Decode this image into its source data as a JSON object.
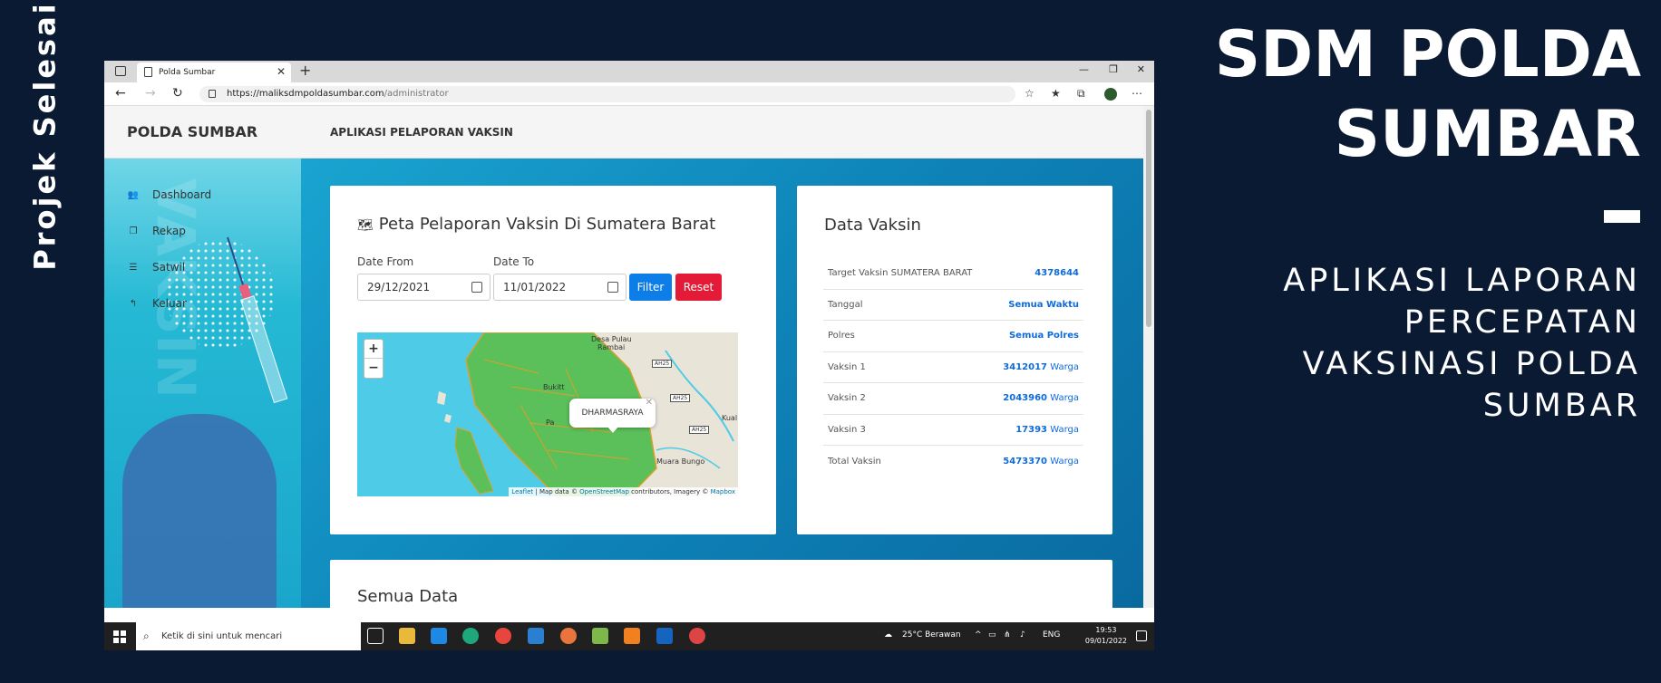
{
  "slide": {
    "vertical_label": "Projek Selesai",
    "title_line1": "SDM POLDA",
    "title_line2": "SUMBAR",
    "subtitle_line1": "APLIKASI LAPORAN",
    "subtitle_line2": "PERCEPATAN",
    "subtitle_line3": "VAKSINASI POLDA",
    "subtitle_line4": "SUMBAR"
  },
  "browser": {
    "tab_title": "Polda Sumbar",
    "url_host": "https://maliksdmpoldasumbar.com",
    "url_path": "/administrator"
  },
  "app": {
    "brand": "POLDA SUMBAR",
    "topbar_title": "APLIKASI PELAPORAN VAKSIN",
    "menu": [
      {
        "label": "Dashboard",
        "icon": "users-icon"
      },
      {
        "label": "Rekap",
        "icon": "copy-icon"
      },
      {
        "label": "Satwil",
        "icon": "list-icon"
      },
      {
        "label": "Keluar",
        "icon": "logout-icon"
      }
    ]
  },
  "map_card": {
    "title": "Peta Pelaporan Vaksin Di Sumatera Barat",
    "date_from_label": "Date From",
    "date_to_label": "Date To",
    "date_from_value": "29/12/2021",
    "date_to_value": "11/01/2022",
    "filter_label": "Filter",
    "reset_label": "Reset",
    "popup_text": "DHARMASRAYA",
    "zoom_in": "+",
    "zoom_out": "−",
    "attribution_leaflet": "Leaflet",
    "attribution_mid": " | Map data © ",
    "attribution_osm": "OpenStreetMap",
    "attribution_mid2": " contributors, Imagery © ",
    "attribution_mapbox": "Mapbox",
    "places": {
      "desa": "Desa Pulau",
      "rambai": "Rambai",
      "bukit": "Bukitt",
      "pa": "Pa",
      "kual": "Kual",
      "muara": "Muara Bungo"
    },
    "roads": [
      "AH25",
      "AH25",
      "AH25"
    ]
  },
  "data_card": {
    "title": "Data Vaksin",
    "rows": [
      {
        "label": "Target Vaksin SUMATERA BARAT",
        "value": "4378644",
        "unit": ""
      },
      {
        "label": "Tanggal",
        "value": "Semua Waktu",
        "unit": ""
      },
      {
        "label": "Polres",
        "value": "Semua Polres",
        "unit": ""
      },
      {
        "label": "Vaksin 1",
        "value": "3412017",
        "unit": "Warga"
      },
      {
        "label": "Vaksin 2",
        "value": "2043960",
        "unit": "Warga"
      },
      {
        "label": "Vaksin 3",
        "value": "17393",
        "unit": "Warga"
      },
      {
        "label": "Total Vaksin",
        "value": "5473370",
        "unit": "Warga"
      }
    ]
  },
  "all_data": {
    "title": "Semua Data"
  },
  "taskbar": {
    "search_placeholder": "Ketik di sini untuk mencari",
    "weather": "25°C  Berawan",
    "lang": "ENG",
    "time": "19:53",
    "date": "09/01/2022"
  },
  "colors": {
    "filter": "#0d7de8",
    "reset": "#e41b37",
    "link": "#0d6bdb",
    "bg": "#0b1a33"
  }
}
